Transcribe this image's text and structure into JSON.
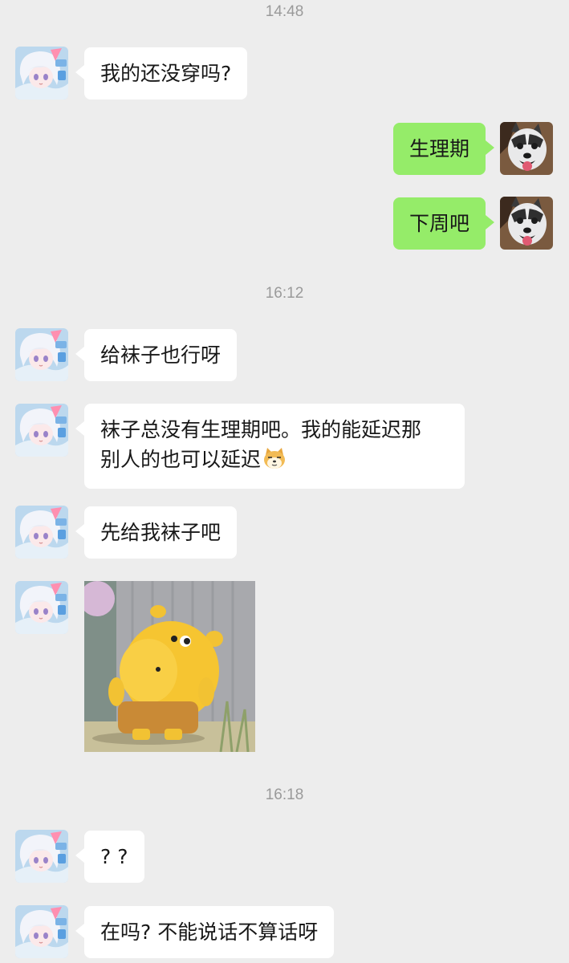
{
  "chat": {
    "time_1": "14:48",
    "time_2": "16:12",
    "time_3": "16:18",
    "messages": {
      "m1": "我的还没穿吗?",
      "m2": "生理期",
      "m3": "下周吧",
      "m4": "给袜子也行呀",
      "m5_line1": "袜子总没有生理期吧。我的能延迟那",
      "m5_line2": "别人的也可以延迟",
      "m6": "先给我袜子吧",
      "m8": "? ?",
      "m9": "在吗? 不能说话不算话呀"
    }
  },
  "icons": {
    "contact_avatar": "anime-girl-avatar",
    "self_avatar": "husky-dog-avatar",
    "inline_emoji": "doge-emoji",
    "sticker": "yellow-hippo-sticker"
  },
  "colors": {
    "background": "#ededed",
    "incoming_bubble": "#ffffff",
    "outgoing_bubble": "#95ec69",
    "timestamp": "#9a9a9a"
  }
}
